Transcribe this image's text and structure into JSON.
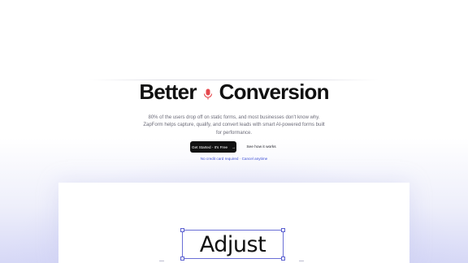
{
  "hero": {
    "title_left": "Better",
    "title_right": "Conversion",
    "mic_icon": "microphone-icon",
    "mic_color": "#e5484d",
    "description": "80% of the users drop off on static forms, and most businesses don't know why. ZapForm helps capture, qualify, and convert leads with smart AI-powered forms built for performance."
  },
  "cta": {
    "primary_label": "Get Started - It's Free",
    "primary_icon": "arrow-right-icon",
    "primary_arrow": "→",
    "secondary_label": "See how it works"
  },
  "note": "No credit card required · Cancel anytime",
  "demo": {
    "adjust_text": "Adjust"
  },
  "colors": {
    "accent": "#3f51d6",
    "text": "#111111",
    "muted": "#6b6b78",
    "selection": "#6a6fd6"
  }
}
